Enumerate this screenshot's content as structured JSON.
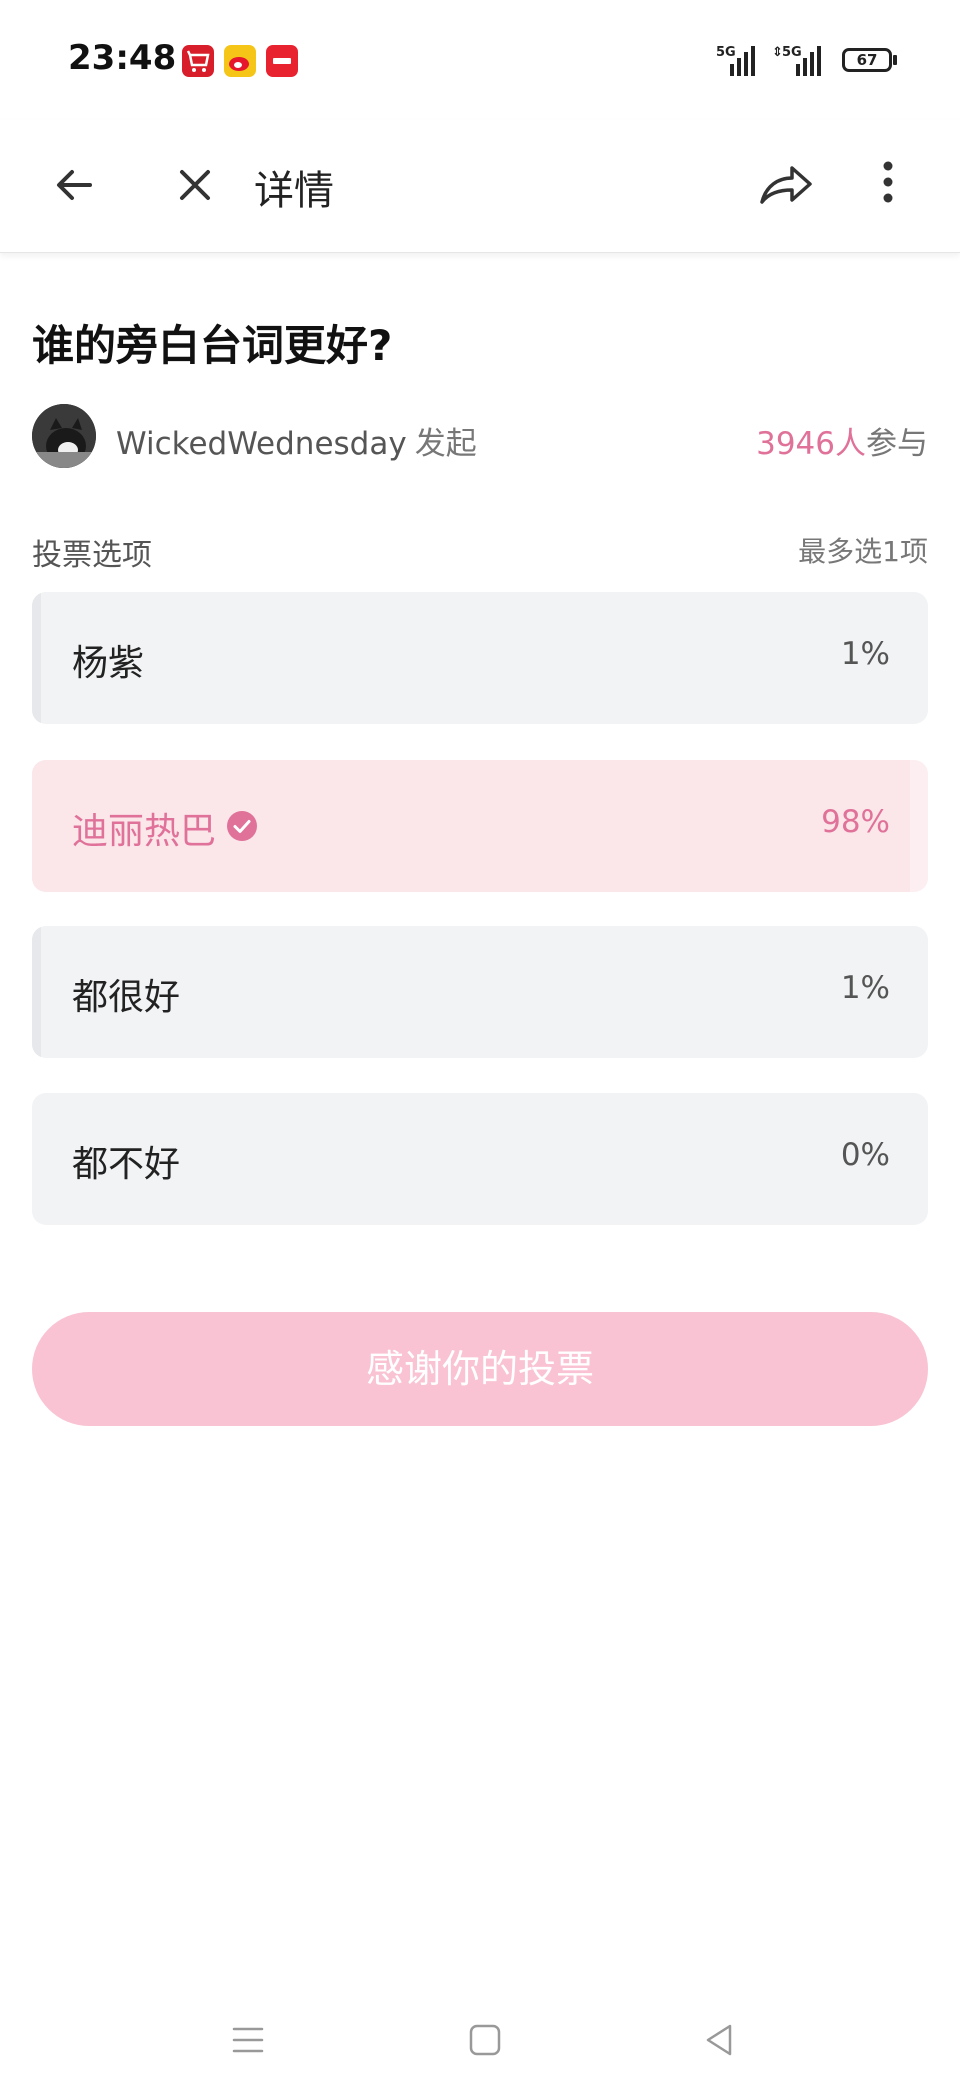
{
  "status_bar": {
    "time": "23:48",
    "signal1": "5G",
    "signal2": "5G",
    "battery": "67"
  },
  "nav": {
    "title": "详情"
  },
  "poll": {
    "title": "谁的旁白台词更好?",
    "author": "WickedWednesday",
    "author_verb": "发起",
    "participant_count": "3946人",
    "participant_suffix": "参与",
    "section_label": "投票选项",
    "section_hint": "最多选1项",
    "options": [
      {
        "label": "杨紫",
        "percent": "1%",
        "share": 0.01,
        "selected": false
      },
      {
        "label": "迪丽热巴",
        "percent": "98%",
        "share": 0.98,
        "selected": true
      },
      {
        "label": "都很好",
        "percent": "1%",
        "share": 0.01,
        "selected": false
      },
      {
        "label": "都不好",
        "percent": "0%",
        "share": 0.0,
        "selected": false
      }
    ],
    "button_label": "感谢你的投票"
  },
  "colors": {
    "accent": "#e0729a",
    "button_bg": "#f9c3d3"
  }
}
